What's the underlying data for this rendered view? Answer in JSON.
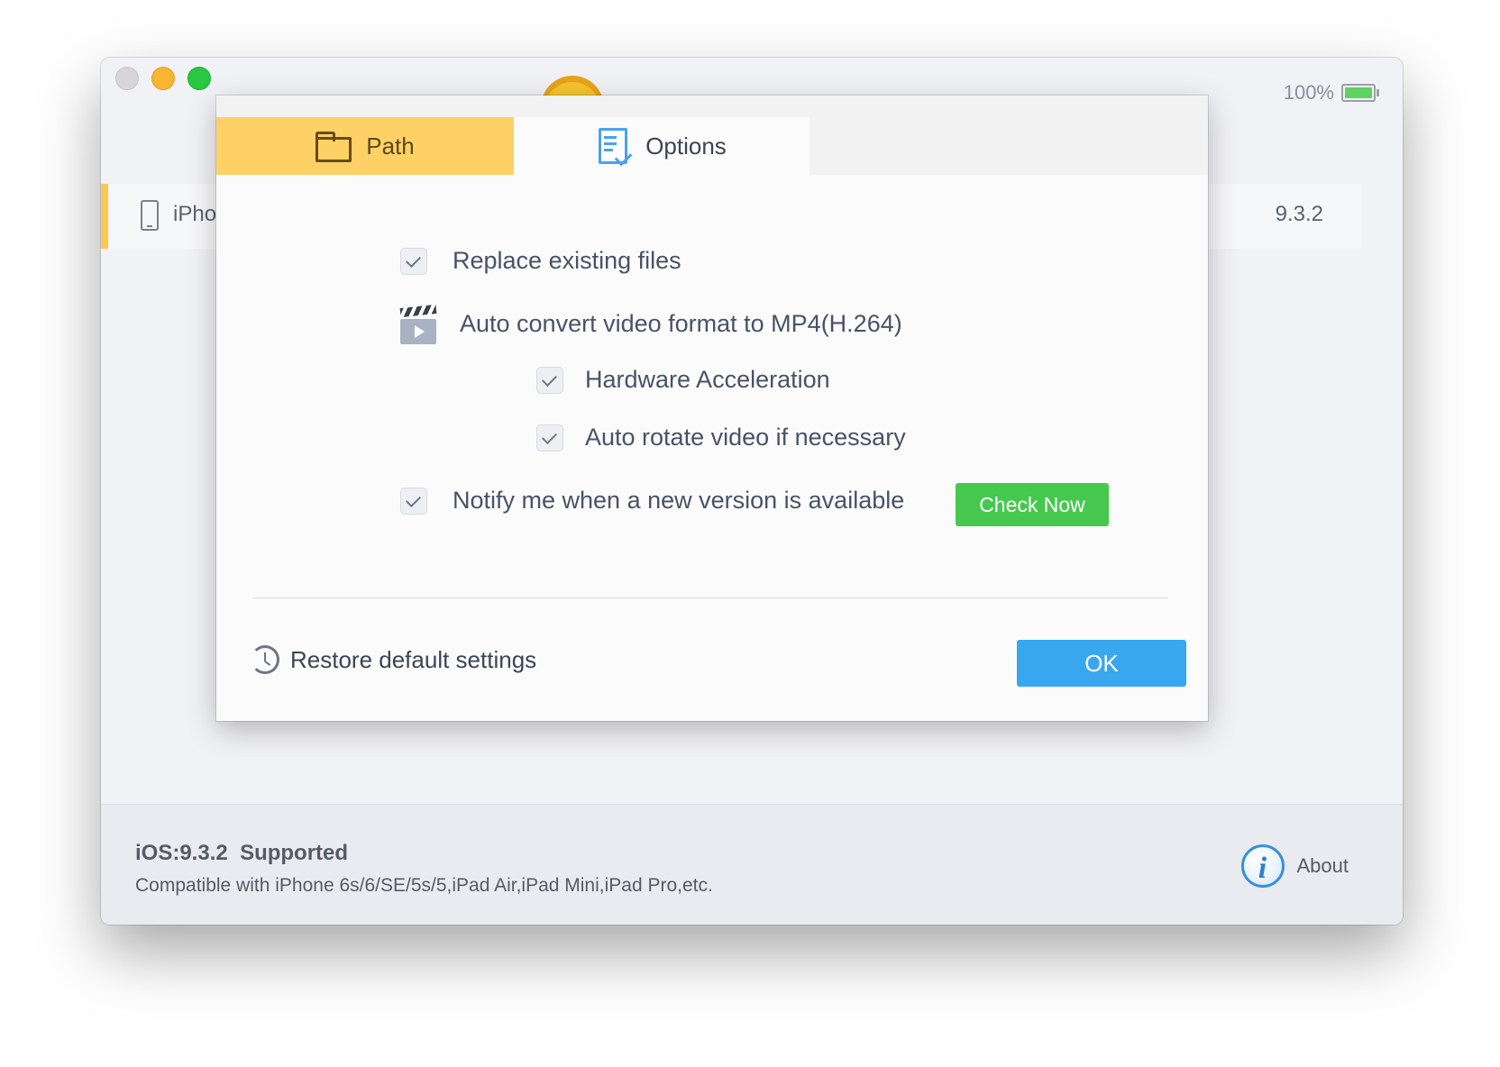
{
  "statusbar": {
    "battery_percent": "100%",
    "battery_level": 1.0
  },
  "device": {
    "name": "iPhone",
    "version": "9.3.2"
  },
  "dialog": {
    "tabs": [
      {
        "label": "Path",
        "active": false,
        "icon": "folder-icon"
      },
      {
        "label": "Options",
        "active": true,
        "icon": "options-document-icon"
      }
    ],
    "options": {
      "replace_existing": {
        "label": "Replace existing files",
        "checked": true
      },
      "auto_convert": {
        "label": "Auto convert video format to MP4(H.264)",
        "icon": "clapperboard-icon"
      },
      "hardware_accel": {
        "label": "Hardware Acceleration",
        "checked": true
      },
      "auto_rotate": {
        "label": "Auto rotate video if necessary",
        "checked": true
      },
      "notify_update": {
        "label": "Notify me when a new version is available",
        "checked": true
      }
    },
    "check_now_label": "Check Now",
    "restore_label": "Restore default settings",
    "ok_label": "OK"
  },
  "footer": {
    "ios_version": "iOS:9.3.2",
    "supported": "Supported",
    "compat": "Compatible with iPhone 6s/6/SE/5s/5,iPad Air,iPad Mini,iPad Pro,etc.",
    "about_label": "About"
  },
  "colors": {
    "accent_yellow": "#fdd166",
    "check_now_green": "#46c84e",
    "ok_blue": "#39a7f0",
    "about_blue": "#3a8fd8"
  }
}
